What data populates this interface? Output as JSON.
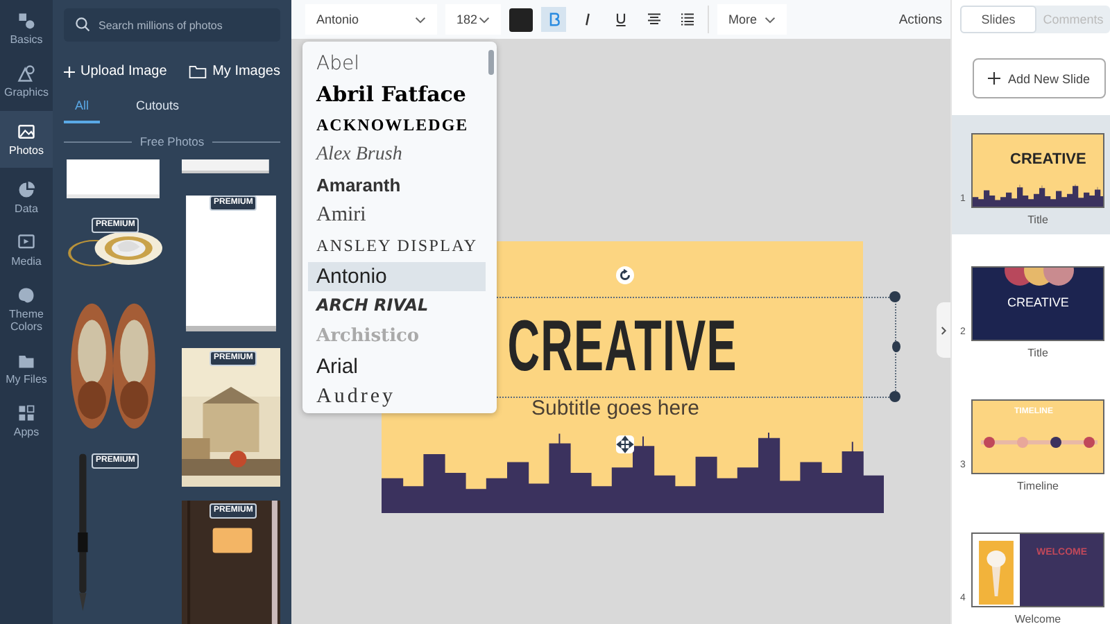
{
  "rail": [
    {
      "label": "Basics",
      "selected": false
    },
    {
      "label": "Graphics",
      "selected": false
    },
    {
      "label": "Photos",
      "selected": true
    },
    {
      "label": "Data",
      "selected": false
    },
    {
      "label": "Media",
      "selected": false
    },
    {
      "label": "Theme Colors",
      "selected": false
    },
    {
      "label": "My Files",
      "selected": false
    },
    {
      "label": "Apps",
      "selected": false
    }
  ],
  "panel": {
    "search": {
      "placeholder": "Search millions of photos"
    },
    "upload": "Upload Image",
    "my_images": "My Images",
    "tabs": [
      {
        "label": "All",
        "selected": true
      },
      {
        "label": "Cutouts",
        "selected": false
      }
    ],
    "section": "Free Photos",
    "photo_columns": [
      [
        {
          "kind": "picture"
        },
        {
          "kind": "picture",
          "badge": "PREMIUM"
        },
        {
          "kind": "picture"
        },
        {
          "kind": "picture",
          "badge": "PREMIUM"
        }
      ],
      [
        {
          "kind": "picture"
        },
        {
          "kind": "picture",
          "badge": "PREMIUM"
        },
        {
          "kind": "picture",
          "badge": "PREMIUM"
        },
        {
          "kind": "picture",
          "badge": "PREMIUM"
        }
      ]
    ]
  },
  "toolbar": {
    "font": "Antonio",
    "size": "182",
    "bold": true,
    "italic": false,
    "underline": false,
    "more": "More",
    "actions": "Actions"
  },
  "font_menu": [
    {
      "label": "Abel",
      "selected": false
    },
    {
      "label": "Abril Fatface",
      "selected": false
    },
    {
      "label": "ACKNOWLEDGE",
      "selected": false
    },
    {
      "label": "Alex Brush",
      "selected": false
    },
    {
      "label": "Amaranth",
      "selected": false
    },
    {
      "label": "Amiri",
      "selected": false
    },
    {
      "label": "ANSLEY DISPLAY",
      "selected": false
    },
    {
      "label": "Antonio",
      "selected": true
    },
    {
      "label": "ARCH RIVAL",
      "selected": false
    },
    {
      "label": "Archistico",
      "selected": false
    },
    {
      "label": "Arial",
      "selected": false
    },
    {
      "label": "Audrey",
      "selected": false
    }
  ],
  "slide": {
    "title": "CREATIVE",
    "subtitle": "Subtitle goes here"
  },
  "right": {
    "tabs": [
      {
        "label": "Slides",
        "selected": true
      },
      {
        "label": "Comments",
        "selected": false
      }
    ],
    "add": "Add New Slide",
    "slides": [
      {
        "number": "1",
        "heading": "CREATIVE",
        "label": "Title",
        "selected": true
      },
      {
        "number": "2",
        "heading": "CREATIVE",
        "label": "Title",
        "selected": false
      },
      {
        "number": "3",
        "heading": "TIMELINE",
        "label": "Timeline",
        "selected": false
      },
      {
        "number": "4",
        "heading": "WELCOME",
        "label": "Welcome",
        "selected": false
      }
    ]
  }
}
